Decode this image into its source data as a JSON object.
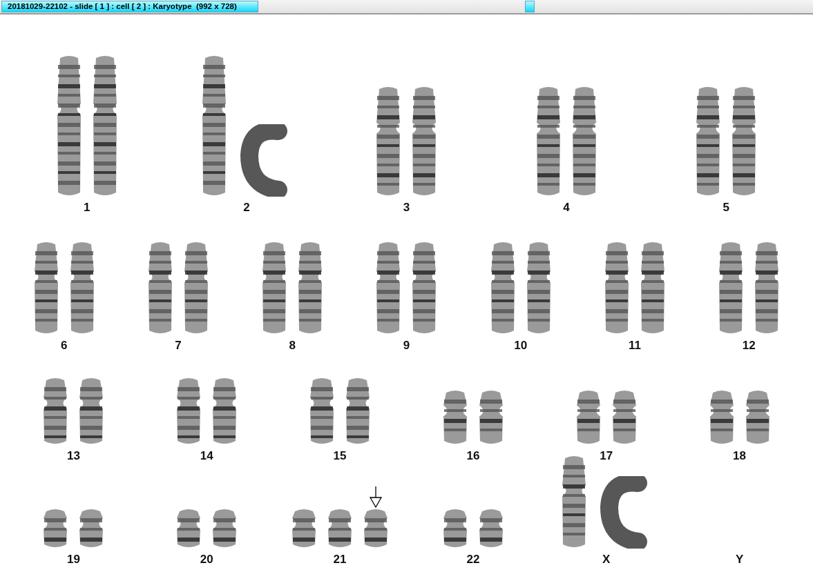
{
  "window": {
    "title": "20181029-22102 - slide [ 1 ] : cell [ 2 ] : Karyotype  (992 x 728)"
  },
  "rows": [
    {
      "groups": [
        {
          "label": "1",
          "chromosomes": [
            {
              "kind": "xl",
              "marked": false
            },
            {
              "kind": "xl",
              "marked": false
            }
          ]
        },
        {
          "label": "2",
          "chromosomes": [
            {
              "kind": "xl",
              "marked": false
            },
            {
              "kind": "bent",
              "marked": false
            }
          ]
        },
        {
          "label": "3",
          "chromosomes": [
            {
              "kind": "l",
              "marked": false
            },
            {
              "kind": "l",
              "marked": false
            }
          ]
        },
        {
          "label": "4",
          "chromosomes": [
            {
              "kind": "l",
              "marked": false
            },
            {
              "kind": "l",
              "marked": false
            }
          ]
        },
        {
          "label": "5",
          "chromosomes": [
            {
              "kind": "l",
              "marked": false
            },
            {
              "kind": "l",
              "marked": false
            }
          ]
        }
      ]
    },
    {
      "groups": [
        {
          "label": "6",
          "chromosomes": [
            {
              "kind": "m",
              "marked": false
            },
            {
              "kind": "m",
              "marked": false
            }
          ]
        },
        {
          "label": "7",
          "chromosomes": [
            {
              "kind": "m",
              "marked": false
            },
            {
              "kind": "m",
              "marked": false
            }
          ]
        },
        {
          "label": "8",
          "chromosomes": [
            {
              "kind": "m",
              "marked": false
            },
            {
              "kind": "m",
              "marked": false
            }
          ]
        },
        {
          "label": "9",
          "chromosomes": [
            {
              "kind": "m",
              "marked": false
            },
            {
              "kind": "m",
              "marked": false
            }
          ]
        },
        {
          "label": "10",
          "chromosomes": [
            {
              "kind": "m",
              "marked": false
            },
            {
              "kind": "m",
              "marked": false
            }
          ]
        },
        {
          "label": "11",
          "chromosomes": [
            {
              "kind": "m",
              "marked": false
            },
            {
              "kind": "m",
              "marked": false
            }
          ]
        },
        {
          "label": "12",
          "chromosomes": [
            {
              "kind": "m",
              "marked": false
            },
            {
              "kind": "m",
              "marked": false
            }
          ]
        }
      ]
    },
    {
      "groups": [
        {
          "label": "13",
          "chromosomes": [
            {
              "kind": "s",
              "marked": false
            },
            {
              "kind": "s",
              "marked": false
            }
          ]
        },
        {
          "label": "14",
          "chromosomes": [
            {
              "kind": "s",
              "marked": false
            },
            {
              "kind": "s",
              "marked": false
            }
          ]
        },
        {
          "label": "15",
          "chromosomes": [
            {
              "kind": "s",
              "marked": false
            },
            {
              "kind": "s",
              "marked": false
            }
          ]
        },
        {
          "label": "16",
          "chromosomes": [
            {
              "kind": "xs",
              "marked": false
            },
            {
              "kind": "xs",
              "marked": false
            }
          ]
        },
        {
          "label": "17",
          "chromosomes": [
            {
              "kind": "xs",
              "marked": false
            },
            {
              "kind": "xs",
              "marked": false
            }
          ]
        },
        {
          "label": "18",
          "chromosomes": [
            {
              "kind": "xs",
              "marked": false
            },
            {
              "kind": "xs",
              "marked": false
            }
          ]
        }
      ]
    },
    {
      "groups": [
        {
          "label": "19",
          "chromosomes": [
            {
              "kind": "xxs",
              "marked": false
            },
            {
              "kind": "xxs",
              "marked": false
            }
          ]
        },
        {
          "label": "20",
          "chromosomes": [
            {
              "kind": "xxs",
              "marked": false
            },
            {
              "kind": "xxs",
              "marked": false
            }
          ]
        },
        {
          "label": "21",
          "chromosomes": [
            {
              "kind": "xxs",
              "marked": false
            },
            {
              "kind": "xxs",
              "marked": false
            },
            {
              "kind": "xxs",
              "marked": true
            }
          ]
        },
        {
          "label": "22",
          "chromosomes": [
            {
              "kind": "xxs",
              "marked": false
            },
            {
              "kind": "xxs",
              "marked": false
            }
          ]
        },
        {
          "label": "X",
          "chromosomes": [
            {
              "kind": "m",
              "marked": false
            },
            {
              "kind": "bent",
              "marked": false
            }
          ]
        },
        {
          "label": "Y"
        }
      ]
    }
  ]
}
